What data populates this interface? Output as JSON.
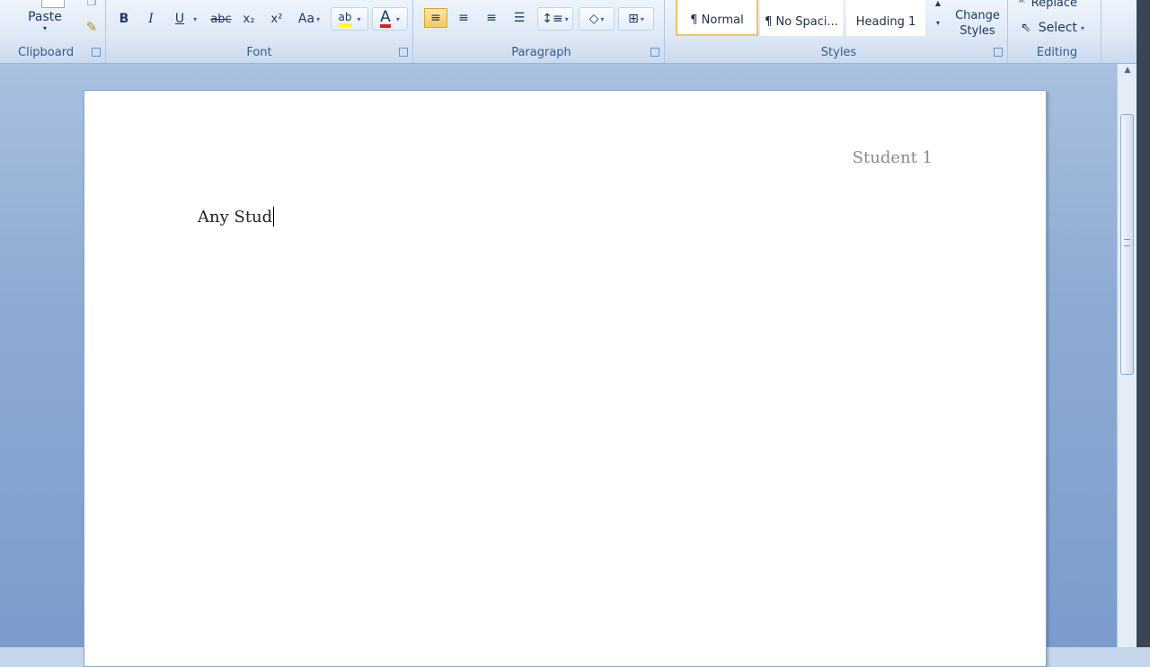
{
  "ribbon": {
    "clipboard": {
      "label": "Clipboard",
      "paste": "Paste"
    },
    "font": {
      "label": "Font",
      "bold": "B",
      "italic": "I",
      "underline": "U",
      "strike": "abc",
      "subscript": "x₂",
      "superscript": "x²",
      "change_case": "Aa",
      "highlight": "ab",
      "font_color": "A"
    },
    "paragraph": {
      "label": "Paragraph"
    },
    "styles": {
      "label": "Styles",
      "items": [
        "¶ Normal",
        "¶ No Spaci...",
        "Heading 1"
      ],
      "change_styles": "Change Styles"
    },
    "editing": {
      "label": "Editing",
      "replace": "Replace",
      "select": "Select"
    }
  },
  "document": {
    "header": "Student 1",
    "body": "Any Stud"
  },
  "colors": {
    "accent": "#f2c25e",
    "highlight": "#ffff00",
    "font_color": "#e02020"
  }
}
